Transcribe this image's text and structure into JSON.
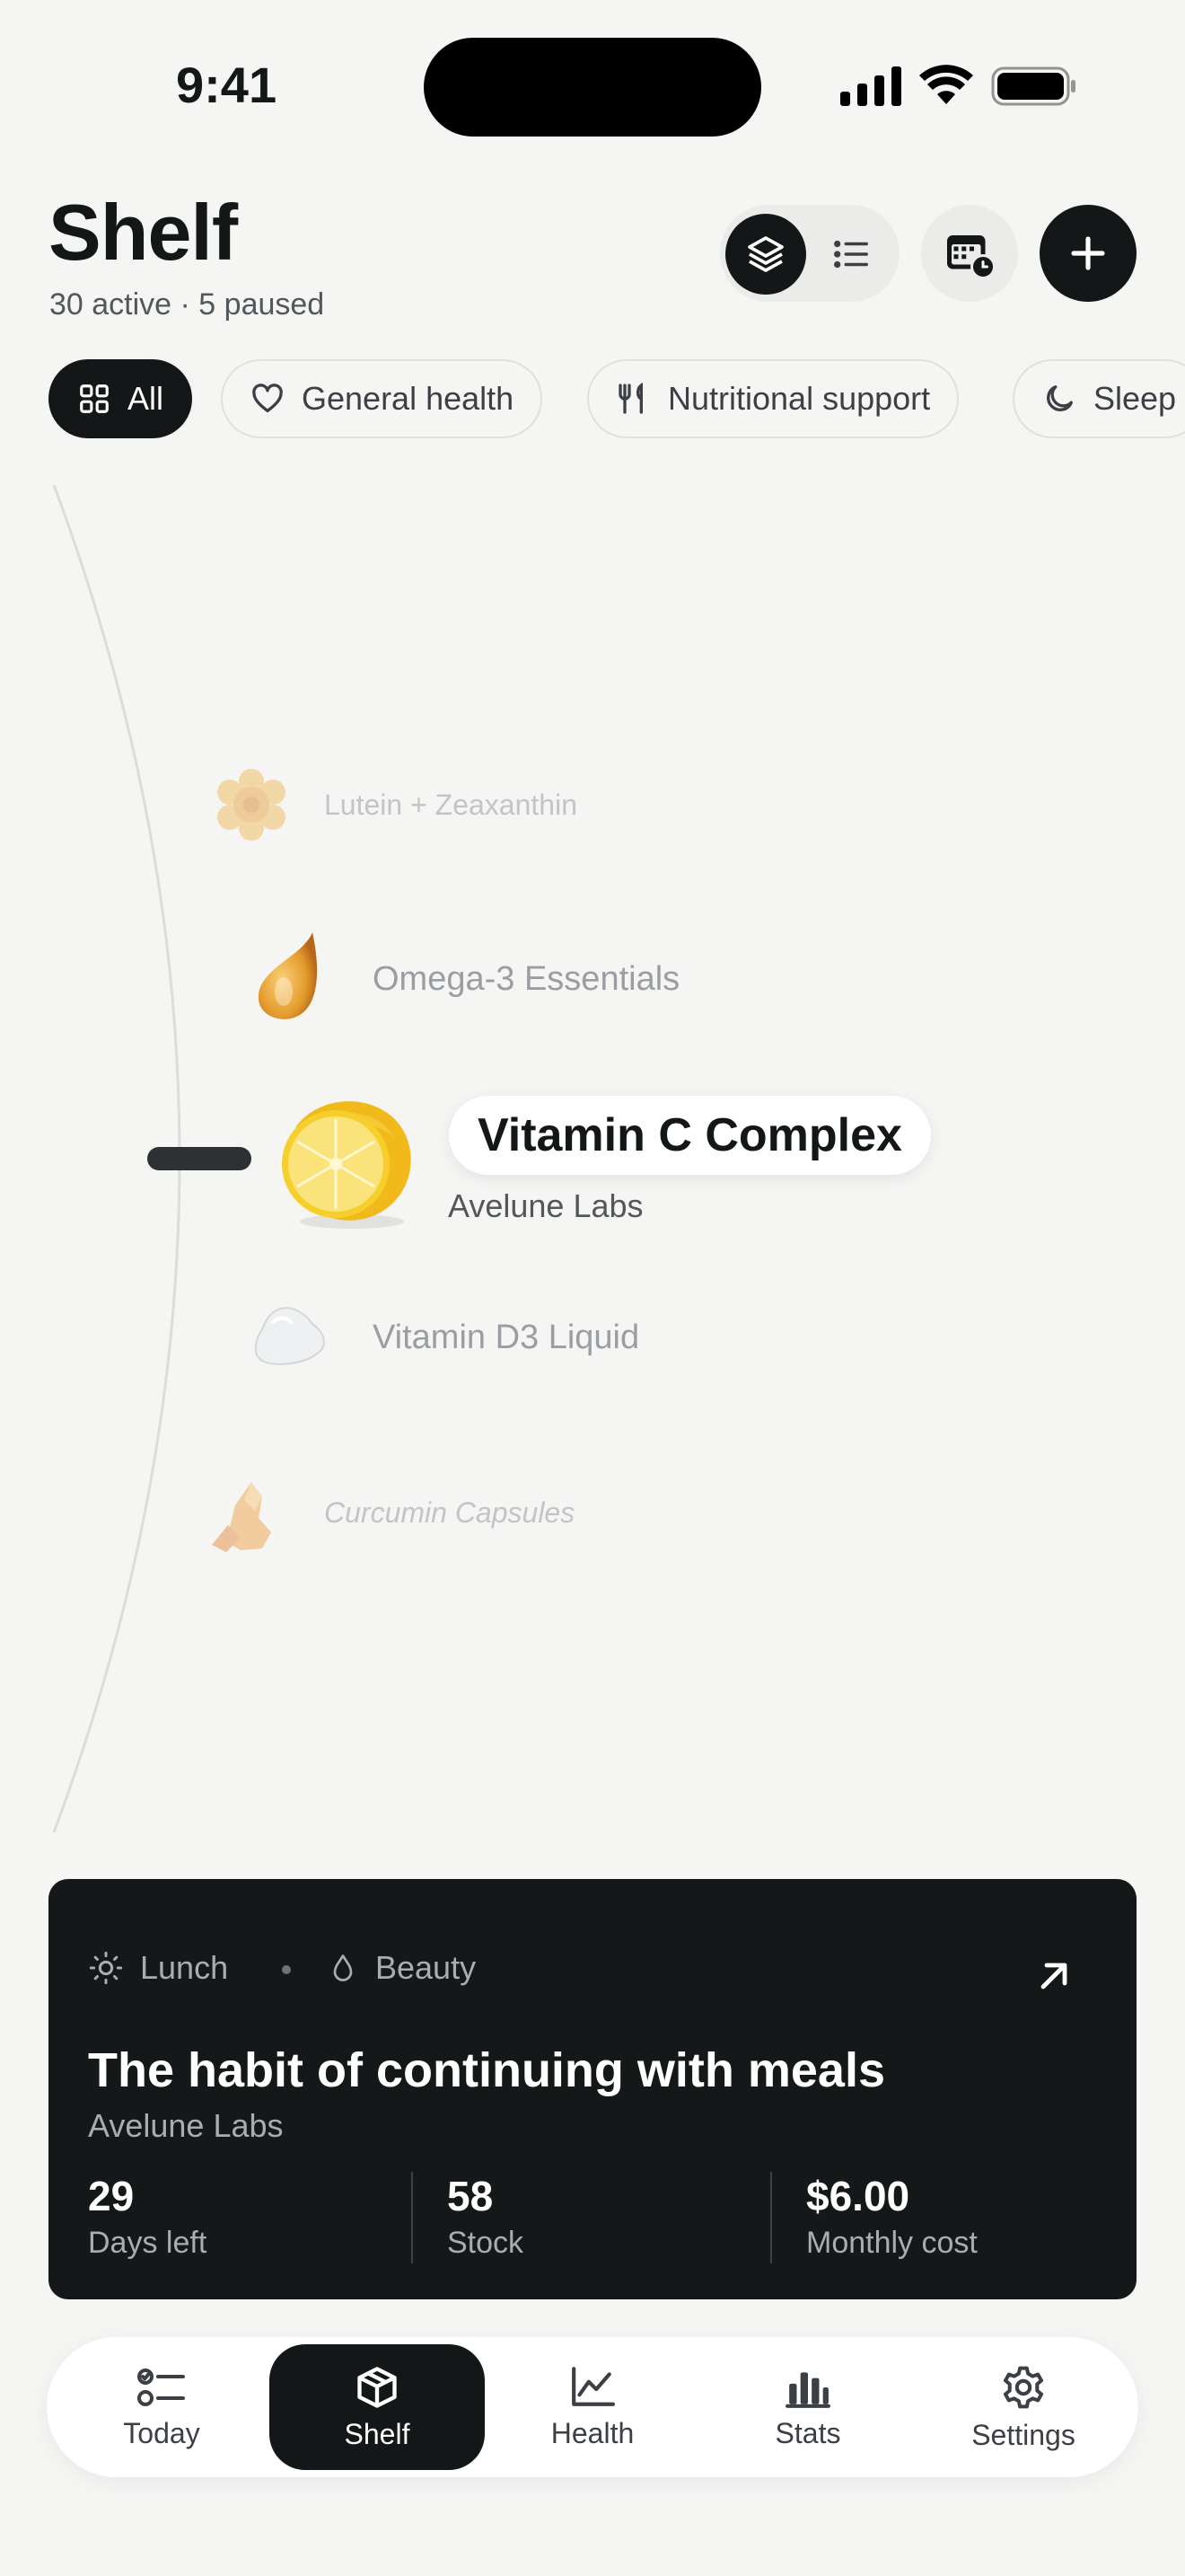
{
  "status_bar": {
    "time": "9:41"
  },
  "header": {
    "title": "Shelf",
    "subtitle": "30 active · 5 paused"
  },
  "filters": [
    {
      "label": "All",
      "icon": "grid-icon",
      "active": true
    },
    {
      "label": "General health",
      "icon": "heart-icon",
      "active": false
    },
    {
      "label": "Nutritional support",
      "icon": "fork-knife-icon",
      "active": false
    },
    {
      "label": "Sleep",
      "icon": "moon-icon",
      "active": false
    }
  ],
  "carousel": {
    "items": [
      {
        "name": "Lutein + Zeaxanthin",
        "icon": "marigold-icon"
      },
      {
        "name": "Omega-3 Essentials",
        "icon": "oil-drop-icon"
      },
      {
        "name": "Vitamin C Complex",
        "brand": "Avelune Labs",
        "icon": "lemon-icon",
        "selected": true
      },
      {
        "name": "Vitamin D3 Liquid",
        "icon": "liquid-drop-icon"
      },
      {
        "name": "Curcumin Capsules",
        "icon": "turmeric-icon"
      }
    ]
  },
  "card": {
    "time_tag": "Lunch",
    "category_tag": "Beauty",
    "title": "The habit of continuing with meals",
    "brand": "Avelune Labs",
    "stats": [
      {
        "value": "29",
        "label": "Days left"
      },
      {
        "value": "58",
        "label": "Stock"
      },
      {
        "value": "$6.00",
        "label": "Monthly cost"
      }
    ]
  },
  "tabs": [
    {
      "label": "Today",
      "icon": "checklist-icon"
    },
    {
      "label": "Shelf",
      "icon": "box-icon",
      "active": true
    },
    {
      "label": "Health",
      "icon": "line-chart-icon"
    },
    {
      "label": "Stats",
      "icon": "bar-chart-icon"
    },
    {
      "label": "Settings",
      "icon": "gear-icon"
    }
  ],
  "colors": {
    "accent": "#141718",
    "background": "#f5f5f4",
    "lemon": "#f5c518"
  }
}
